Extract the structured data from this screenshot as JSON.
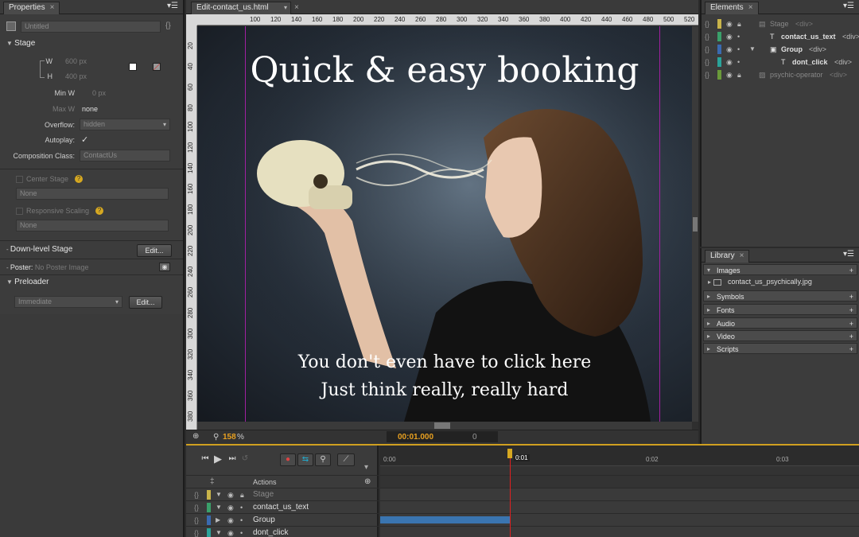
{
  "properties": {
    "tab": "Properties",
    "title_placeholder": "Untitled",
    "stage_section": "Stage",
    "w_label": "W",
    "w_value": "600 px",
    "h_label": "H",
    "h_value": "400 px",
    "minw_label": "Min W",
    "minw_value": "0 px",
    "maxw_label": "Max W",
    "maxw_value": "none",
    "overflow_label": "Overflow:",
    "overflow_value": "hidden",
    "autoplay_label": "Autoplay:",
    "autoplay_check": "✓",
    "comp_class_label": "Composition Class:",
    "comp_class_placeholder": "ContactUs",
    "center_stage": "Center Stage",
    "center_stage_select": "None",
    "responsive_scaling": "Responsive Scaling",
    "responsive_select": "None",
    "downlevel_label": "Down-level Stage",
    "edit_label": "Edit...",
    "poster_label": "Poster:",
    "poster_value": "No Poster Image",
    "preloader_label": "Preloader",
    "preloader_select": "Immediate",
    "preloader_edit": "Edit..."
  },
  "stage": {
    "file_tab": "Edit-contact_us.html",
    "headline": "Quick & easy booking",
    "line1": "You don't even have to click here",
    "line2": "Just think really, really hard",
    "zoom": "158",
    "zoom_unit": "%",
    "time": "00:01.000",
    "frame": "0",
    "ruler_h": [
      "100",
      "120",
      "140",
      "160",
      "180",
      "200",
      "220",
      "240",
      "260",
      "280",
      "300",
      "320",
      "340",
      "360",
      "380",
      "400",
      "420",
      "440",
      "460",
      "480",
      "500",
      "520"
    ],
    "ruler_v": [
      "20",
      "40",
      "60",
      "80",
      "100",
      "120",
      "140",
      "160",
      "180",
      "200",
      "220",
      "240",
      "260",
      "280",
      "300",
      "320",
      "340",
      "360",
      "380"
    ]
  },
  "elements": {
    "tab": "Elements",
    "items": [
      {
        "name": "Stage",
        "tag": "<div>",
        "color": "#c9b44a",
        "dim": true
      },
      {
        "name": "contact_us_text",
        "tag": "<div>",
        "color": "#3aa06a",
        "dim": false
      },
      {
        "name": "Group",
        "tag": "<div>",
        "color": "#3a6ab0",
        "dim": false
      },
      {
        "name": "dont_click",
        "tag": "<div>",
        "color": "#2aa39a",
        "dim": false
      },
      {
        "name": "psychic-operator",
        "tag": "<div>",
        "color": "#6a9a3a",
        "dim": true
      }
    ]
  },
  "library": {
    "tab": "Library",
    "images": "Images",
    "image_file": "contact_us_psychically.jpg",
    "symbols": "Symbols",
    "fonts": "Fonts",
    "audio": "Audio",
    "video": "Video",
    "scripts": "Scripts"
  },
  "timeline": {
    "actions": "Actions",
    "marker0": "0:00",
    "marker1": "0:01",
    "marker2": "0:02",
    "marker3": "0:03",
    "rows": [
      "Stage",
      "contact_us_text",
      "Group",
      "dont_click"
    ]
  }
}
